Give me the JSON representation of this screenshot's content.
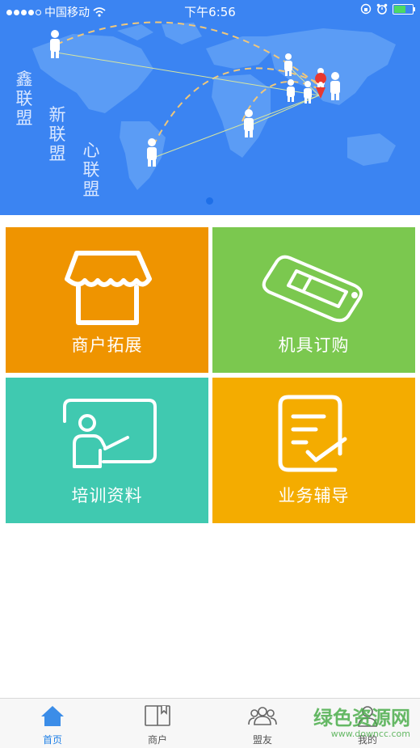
{
  "status_bar": {
    "carrier": "中国移动",
    "time": "下午6:56"
  },
  "banner": {
    "labels": [
      "鑫联盟",
      "新联盟",
      "心联盟"
    ]
  },
  "tiles": [
    {
      "label": "商户拓展",
      "color": "#ef9400",
      "icon": "store-icon"
    },
    {
      "label": "机具订购",
      "color": "#7bc84f",
      "icon": "pos-terminal-icon"
    },
    {
      "label": "培训资料",
      "color": "#40c9b0",
      "icon": "teacher-board-icon"
    },
    {
      "label": "业务辅导",
      "color": "#f4ac00",
      "icon": "notepad-check-icon"
    }
  ],
  "tab_bar": {
    "items": [
      {
        "label": "首页",
        "icon": "home-icon",
        "active": true
      },
      {
        "label": "商户",
        "icon": "book-icon",
        "active": false
      },
      {
        "label": "盟友",
        "icon": "people-icon",
        "active": false
      },
      {
        "label": "我的",
        "icon": "user-icon",
        "active": false
      }
    ]
  },
  "watermark": {
    "text": "绿色资源网",
    "url": "www.downcc.com"
  }
}
